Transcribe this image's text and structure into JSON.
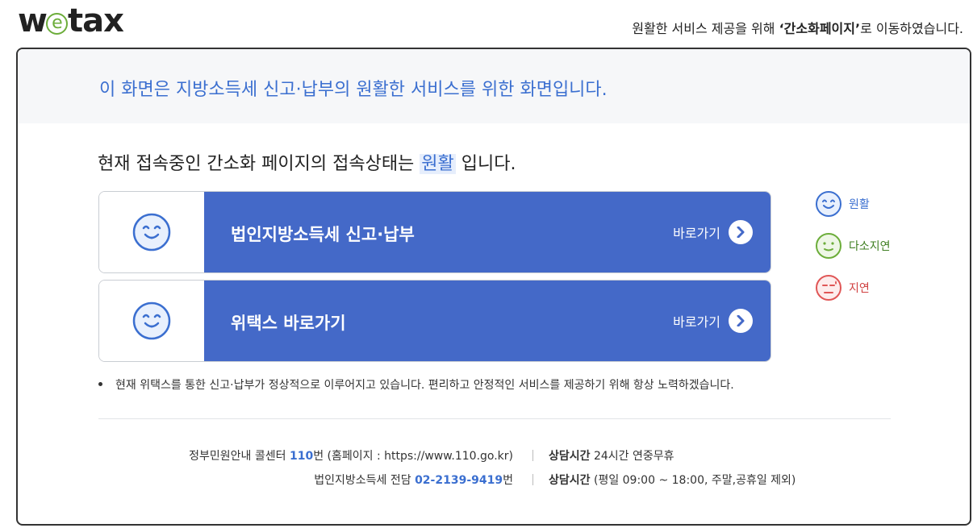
{
  "header": {
    "logo_w": "w",
    "logo_e": "e",
    "logo_rest": "tax",
    "notice_pre": "원활한 서비스 제공을 위해 ",
    "notice_bold": "‘간소화페이지’",
    "notice_post": "로 이동하였습니다."
  },
  "main": {
    "intro": "이 화면은 지방소득세 신고·납부의 원활한 서비스를 위한 화면입니다.",
    "status_pre": "현재 접속중인 간소화 페이지의 접속상태는 ",
    "status_value": "원활",
    "status_post": " 입니다.",
    "links": [
      {
        "title": "법인지방소득세 신고·납부",
        "go_label": "바로가기"
      },
      {
        "title": "위택스 바로가기",
        "go_label": "바로가기"
      }
    ],
    "notice_bullet": "현재 위택스를 통한 신고·납부가 정상적으로 이루어지고 있습니다. 편리하고 안정적인 서비스를 제공하기 위해 항상 노력하겠습니다."
  },
  "legend": [
    {
      "label": "원활",
      "color": "#3b6fd0",
      "icon": "smile-face-icon"
    },
    {
      "label": "다소지연",
      "color": "#6cad3a",
      "icon": "neutral-face-icon"
    },
    {
      "label": "지연",
      "color": "#e05656",
      "icon": "sad-face-icon"
    }
  ],
  "footer": {
    "line1_pre": "정부민원안내 콜센터 ",
    "line1_num": "110",
    "line1_post": "번 (홈페이지 : https://www.110.go.kr)",
    "line1_hours_label": "상담시간",
    "line1_hours_value": " 24시간 연중무휴",
    "line2_pre": "법인지방소득세 전담 ",
    "line2_num": "02-2139-9419",
    "line2_post": "번",
    "line2_hours_label": "상담시간",
    "line2_hours_value": " (평일 09:00 ~ 18:00, 주말,공휴일 제외)"
  },
  "colors": {
    "accent": "#3b6fd0",
    "button_bar": "#4469c8",
    "green": "#6cad3a",
    "red": "#e05656"
  }
}
